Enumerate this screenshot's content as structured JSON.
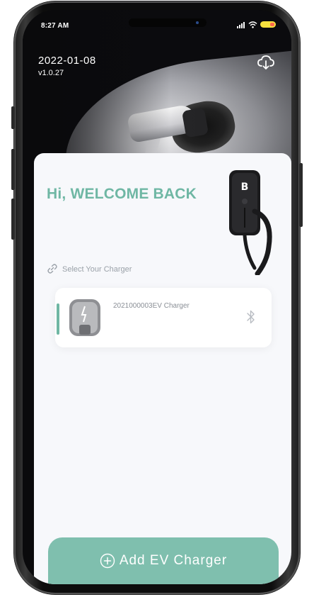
{
  "status_bar": {
    "time": "8:27 AM"
  },
  "header": {
    "date": "2022-01-08",
    "version": "v1.0.27",
    "cloud_icon": "cloud-download-icon"
  },
  "main": {
    "greeting": "Hi, WELCOME BACK",
    "select_label": "Select Your Charger",
    "link_icon": "link-icon"
  },
  "charger_list": [
    {
      "name": "2021000003EV Charger",
      "connection_icon": "bluetooth-icon"
    }
  ],
  "footer": {
    "add_label": "Add EV Charger",
    "add_icon": "plus-circle-icon"
  },
  "colors": {
    "accent": "#6fb7a4",
    "button": "#7fbfae",
    "card_bg": "#f7f8fb",
    "hero_bg": "#0b0b0e"
  }
}
